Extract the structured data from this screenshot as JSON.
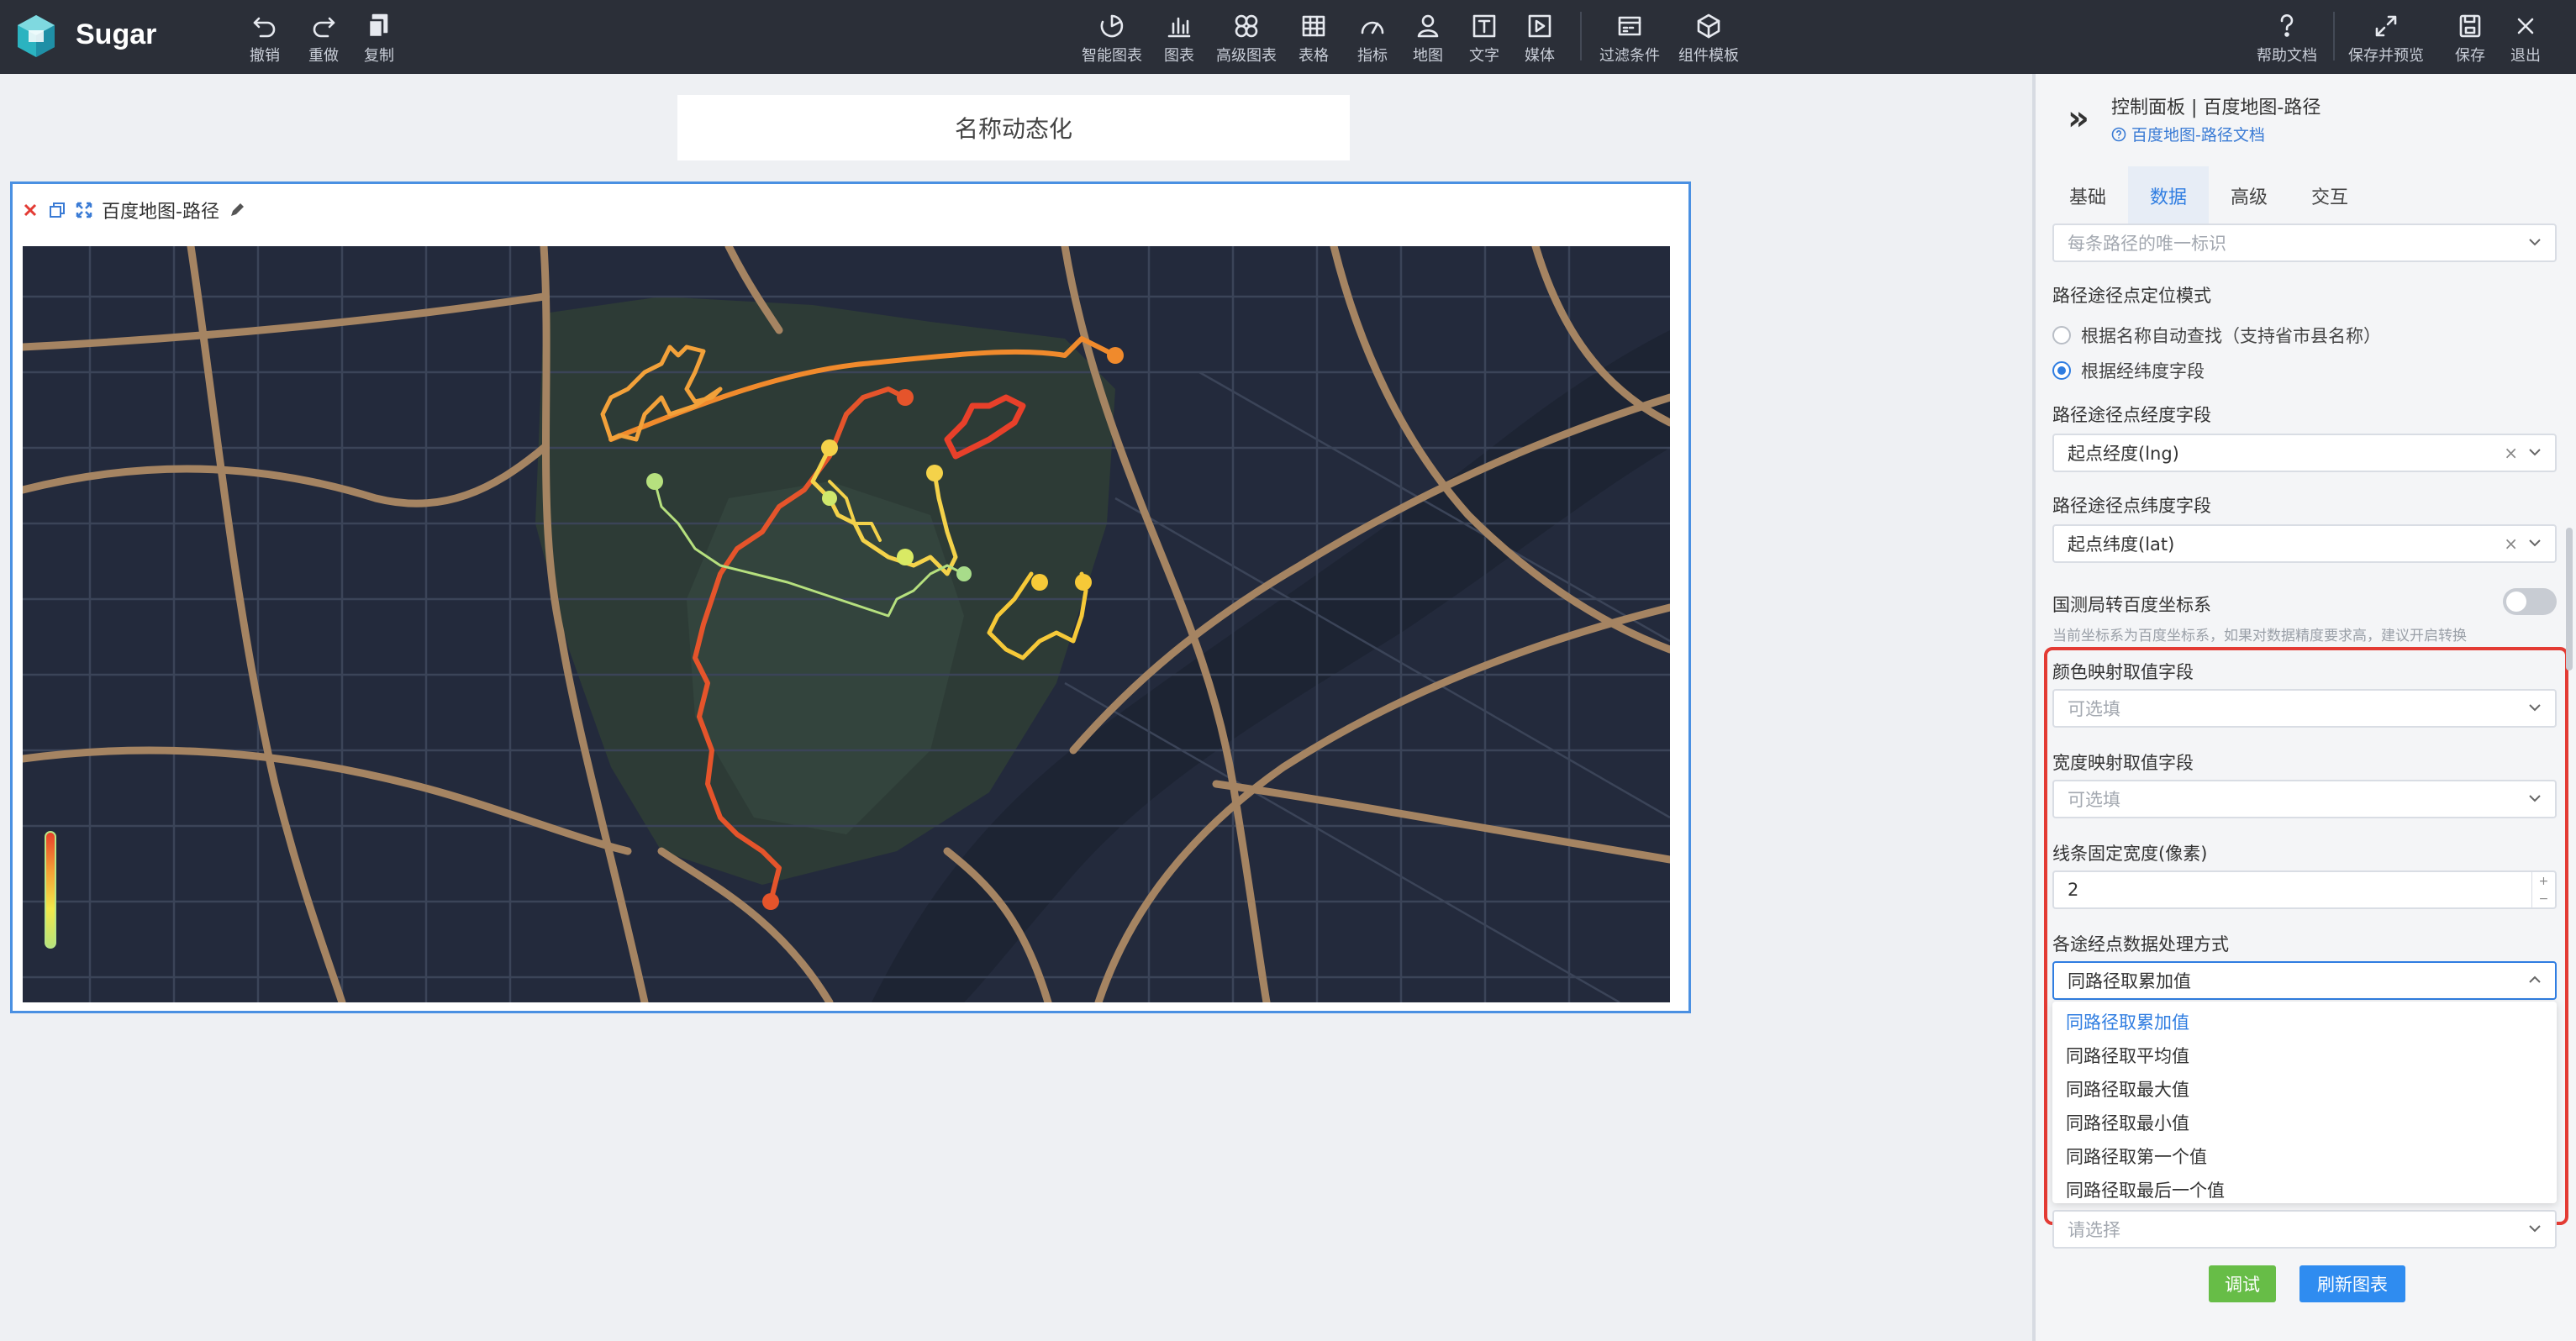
{
  "app": {
    "brand": "Sugar"
  },
  "toolbar": {
    "left": [
      {
        "label": "撤销",
        "icon": "undo-icon"
      },
      {
        "label": "重做",
        "icon": "redo-icon"
      },
      {
        "label": "复制",
        "icon": "copy-icon"
      }
    ],
    "center": [
      {
        "label": "智能图表",
        "icon": "smart-chart-icon"
      },
      {
        "label": "图表",
        "icon": "bar-chart-icon"
      },
      {
        "label": "高级图表",
        "icon": "advanced-chart-icon"
      },
      {
        "label": "表格",
        "icon": "table-icon"
      },
      {
        "label": "指标",
        "icon": "gauge-icon"
      },
      {
        "label": "地图",
        "icon": "map-pin-icon"
      },
      {
        "label": "文字",
        "icon": "text-icon"
      },
      {
        "label": "媒体",
        "icon": "media-icon"
      },
      {
        "label": "过滤条件",
        "icon": "filter-icon"
      },
      {
        "label": "组件模板",
        "icon": "template-icon"
      }
    ],
    "right": [
      {
        "label": "帮助文档",
        "icon": "help-icon"
      },
      {
        "label": "保存并预览",
        "icon": "expand-icon"
      },
      {
        "label": "保存",
        "icon": "save-icon"
      },
      {
        "label": "退出",
        "icon": "close-icon"
      }
    ]
  },
  "canvas": {
    "title_text": "名称动态化",
    "chart_title": "百度地图-路径"
  },
  "map": {
    "route_colors": [
      "#e8402a",
      "#f08a2c",
      "#f6d046",
      "#b6e07e"
    ],
    "legend_gradient": [
      "#e8402a",
      "#f4a035",
      "#f2e84a",
      "#b7e27a"
    ]
  },
  "panel": {
    "title": "控制面板 | 百度地图-路径",
    "doc_link": "百度地图-路径文档",
    "tabs": [
      "基础",
      "数据",
      "高级",
      "交互"
    ],
    "active_tab": "数据",
    "route_id_placeholder": "每条路径的唯一标识",
    "waypoint_mode_label": "路径途径点定位模式",
    "waypoint_mode_options": [
      "根据名称自动查找（支持省市县名称）",
      "根据经纬度字段"
    ],
    "waypoint_mode_selected": "根据经纬度字段",
    "lng_label": "路径途径点经度字段",
    "lng_value": "起点经度(lng)",
    "lat_label": "路径途径点纬度字段",
    "lat_value": "起点纬度(lat)",
    "coord_toggle_label": "国测局转百度坐标系",
    "coord_toggle_on": false,
    "coord_hint": "当前坐标系为百度坐标系，如果对数据精度要求高，建议开启转换",
    "color_map_label": "颜色映射取值字段",
    "color_map_placeholder": "可选填",
    "width_map_label": "宽度映射取值字段",
    "width_map_placeholder": "可选填",
    "line_width_label": "线条固定宽度(像素)",
    "line_width_value": "2",
    "waypoint_process_label": "各途经点数据处理方式",
    "waypoint_process_value": "同路径取累加值",
    "waypoint_process_options": [
      "同路径取累加值",
      "同路径取平均值",
      "同路径取最大值",
      "同路径取最小值",
      "同路径取第一个值",
      "同路径取最后一个值"
    ],
    "below_select_placeholder": "请选择",
    "debug_button": "调试",
    "refresh_button": "刷新图表"
  }
}
